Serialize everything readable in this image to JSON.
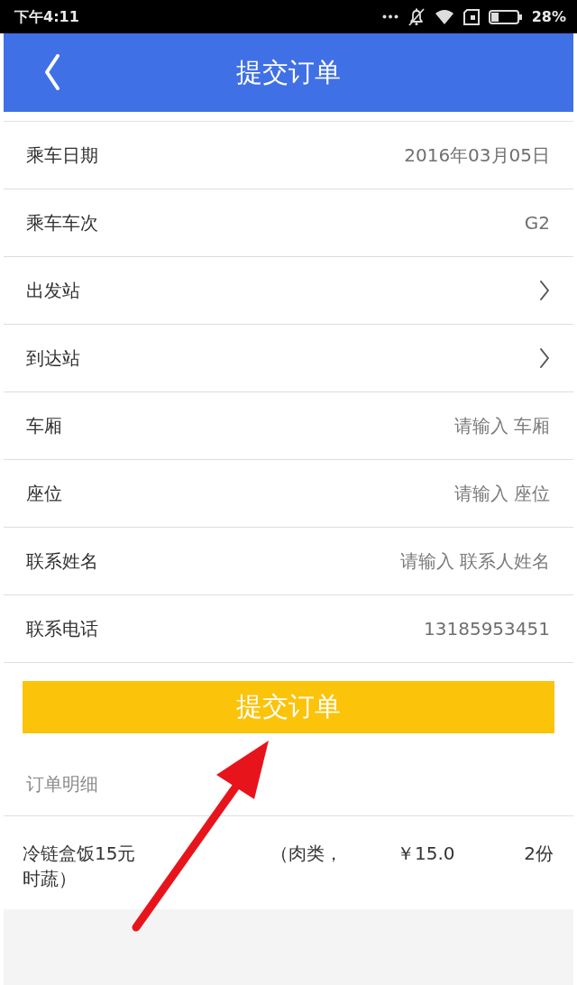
{
  "status_bar": {
    "time": "下午4:11",
    "battery": "28%"
  },
  "header": {
    "title": "提交订单"
  },
  "form": [
    {
      "label": "乘车日期",
      "kind": "text",
      "value": "2016年03月05日"
    },
    {
      "label": "乘车车次",
      "kind": "text",
      "value": "G2"
    },
    {
      "label": "出发站",
      "kind": "select"
    },
    {
      "label": "到达站",
      "kind": "select"
    },
    {
      "label": "车厢",
      "kind": "input",
      "placeholder": "请输入 车厢"
    },
    {
      "label": "座位",
      "kind": "input",
      "placeholder": "请输入 座位"
    },
    {
      "label": "联系姓名",
      "kind": "input",
      "placeholder": "请输入 联系人姓名"
    },
    {
      "label": "联系电话",
      "kind": "input",
      "value": "13185953451"
    }
  ],
  "submit_button": {
    "label": "提交订单"
  },
  "order_details": {
    "title": "订单明细",
    "items": [
      {
        "name_lines": [
          "冷链盒饭15元",
          "时蔬）"
        ],
        "detail": "（肉类，",
        "price": "￥15.0",
        "quantity": "2份"
      }
    ]
  }
}
